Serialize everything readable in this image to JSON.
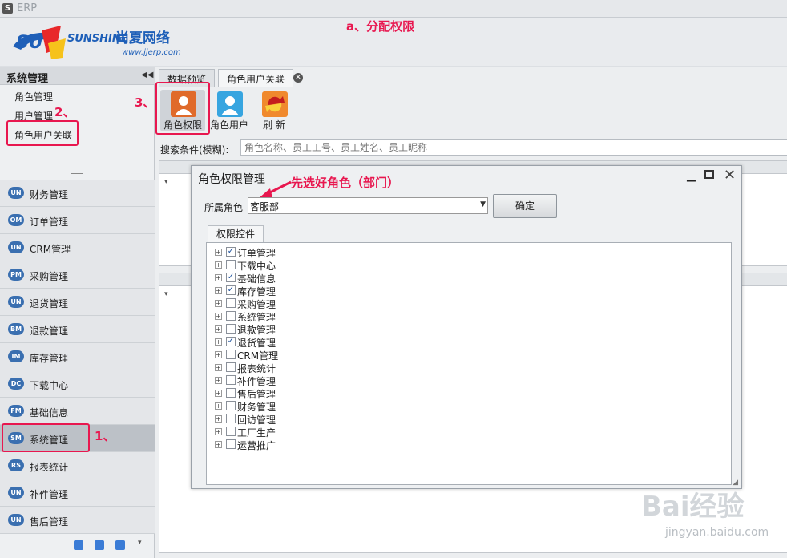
{
  "app": {
    "title": "ERP",
    "icon": "S"
  },
  "logo": {
    "brand": "SUNSHINE",
    "name_cn": "尚夏网络",
    "url": "www.jjerp.com"
  },
  "annotations": {
    "a": "a、分配权限",
    "step1": "1、",
    "step2": "2、",
    "step3": "3、",
    "dialog_hint": "先选好角色（部门）"
  },
  "sidebar": {
    "title": "系统管理",
    "sub_items": [
      "角色管理",
      "用户管理",
      "角色用户关联"
    ],
    "modules": [
      {
        "badge": "UN",
        "label": "财务管理"
      },
      {
        "badge": "OM",
        "label": "订单管理"
      },
      {
        "badge": "UN",
        "label": "CRM管理"
      },
      {
        "badge": "PM",
        "label": "采购管理"
      },
      {
        "badge": "UN",
        "label": "退货管理"
      },
      {
        "badge": "BM",
        "label": "退款管理"
      },
      {
        "badge": "IM",
        "label": "库存管理"
      },
      {
        "badge": "DC",
        "label": "下载中心"
      },
      {
        "badge": "FM",
        "label": "基础信息"
      },
      {
        "badge": "SM",
        "label": "系统管理"
      },
      {
        "badge": "RS",
        "label": "报表统计"
      },
      {
        "badge": "UN",
        "label": "补件管理"
      },
      {
        "badge": "UN",
        "label": "售后管理"
      }
    ]
  },
  "tabs": [
    {
      "label": "数据预览"
    },
    {
      "label": "角色用户关联"
    }
  ],
  "toolbar": {
    "role_perm": "角色权限",
    "role_user": "角色用户",
    "refresh": "刷 新"
  },
  "search": {
    "label": "搜索条件(模糊):",
    "placeholder": "角色名称、员工工号、员工姓名、员工昵称"
  },
  "dialog": {
    "title": "角色权限管理",
    "role_label": "所属角色",
    "role_value": "客服部",
    "confirm": "确定",
    "perm_tab": "权限控件",
    "tree": [
      {
        "label": "订单管理",
        "checked": true
      },
      {
        "label": "下载中心",
        "checked": false
      },
      {
        "label": "基础信息",
        "checked": true
      },
      {
        "label": "库存管理",
        "checked": true
      },
      {
        "label": "采购管理",
        "checked": false
      },
      {
        "label": "系统管理",
        "checked": false
      },
      {
        "label": "退款管理",
        "checked": false
      },
      {
        "label": "退货管理",
        "checked": true
      },
      {
        "label": "CRM管理",
        "checked": false
      },
      {
        "label": "报表统计",
        "checked": false
      },
      {
        "label": "补件管理",
        "checked": false
      },
      {
        "label": "售后管理",
        "checked": false
      },
      {
        "label": "财务管理",
        "checked": false
      },
      {
        "label": "回访管理",
        "checked": false
      },
      {
        "label": "工厂生产",
        "checked": false
      },
      {
        "label": "运营推广",
        "checked": false
      }
    ]
  },
  "watermark": {
    "text": "Bai经验",
    "url": "jingyan.baidu.com"
  },
  "colors": {
    "accent": "#e8174f",
    "badge": "#3a6fb0"
  }
}
